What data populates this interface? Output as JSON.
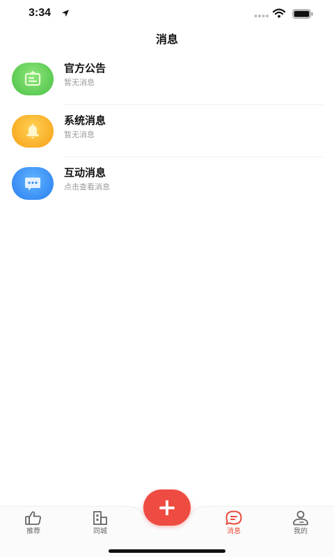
{
  "status_bar": {
    "time": "3:34"
  },
  "header": {
    "title": "消息"
  },
  "messages": [
    {
      "title": "官方公告",
      "subtitle": "暂无消息",
      "color": "#5dcc55",
      "icon": "announcement-icon"
    },
    {
      "title": "系统消息",
      "subtitle": "暂无消息",
      "color": "#f9ae28",
      "icon": "bell-icon"
    },
    {
      "title": "互动消息",
      "subtitle": "点击查看消息",
      "color": "#3a8ef5",
      "icon": "chat-bubble-icon"
    }
  ],
  "tab_bar": {
    "tabs": [
      {
        "label": "推荐",
        "icon": "thumbs-up-icon",
        "active": false
      },
      {
        "label": "同城",
        "icon": "building-icon",
        "active": false
      },
      {
        "label": "消息",
        "icon": "message-icon",
        "active": true
      },
      {
        "label": "我的",
        "icon": "profile-icon",
        "active": false
      }
    ],
    "fab_label": "+",
    "accent_color": "#e94b3c"
  }
}
